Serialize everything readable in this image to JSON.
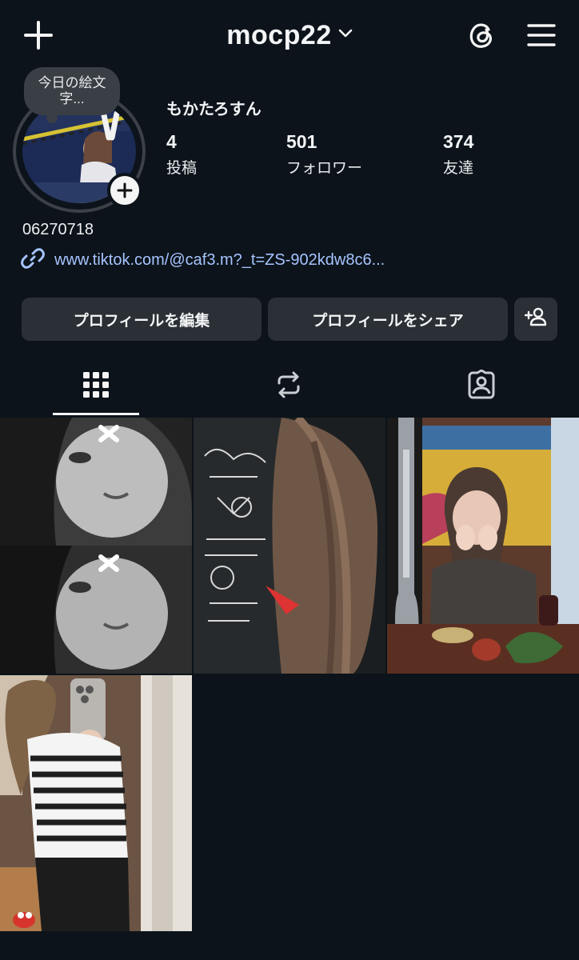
{
  "header": {
    "username": "mocp22",
    "new_post_icon": "plus-icon",
    "threads_icon": "threads-icon",
    "menu_icon": "hamburger-menu-icon"
  },
  "profile": {
    "note": "今日の絵文字...",
    "display_name": "もかたろすん",
    "stats": [
      {
        "value": "4",
        "label": "投稿"
      },
      {
        "value": "501",
        "label": "フォロワー"
      },
      {
        "value": "374",
        "label": "友達"
      }
    ],
    "bio": "06270718",
    "link": "www.tiktok.com/@caf3.m?_t=ZS-902kdw8c6..."
  },
  "actions": {
    "edit_label": "プロフィールを編集",
    "share_label": "プロフィールをシェア"
  },
  "tabs": [
    "grid-icon",
    "repost-icon",
    "tagged-icon"
  ],
  "colors": {
    "background": "#0c131a",
    "button": "#2a3036",
    "link": "#a6c4ff"
  }
}
